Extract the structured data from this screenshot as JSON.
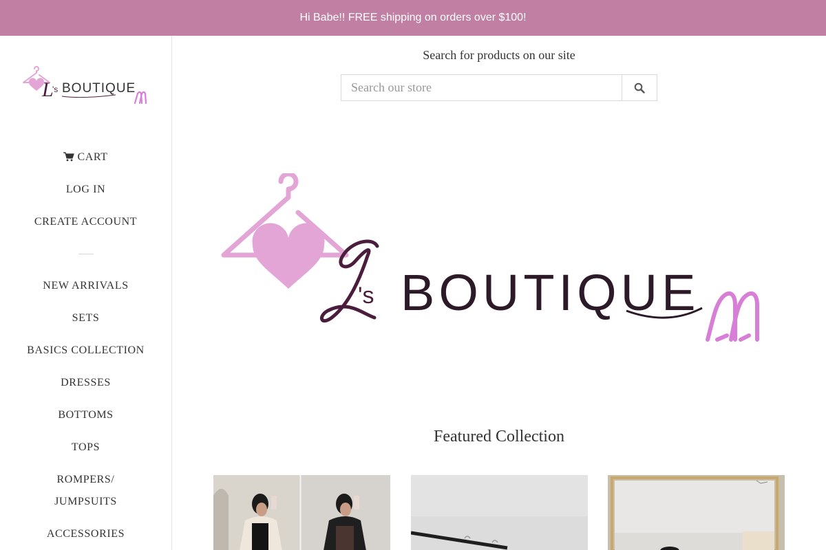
{
  "announcement": {
    "text": "Hi Babe!! FREE shipping on orders over $100!"
  },
  "brand": {
    "logo_text": "L's BOUTIQUE",
    "logo_letter": "L",
    "logo_suffix": "'s",
    "logo_word": "BOUTIQUE"
  },
  "sidebar": {
    "account_links": [
      {
        "label": "Cart"
      },
      {
        "label": "Log in"
      },
      {
        "label": "Create account"
      }
    ],
    "nav": [
      {
        "label": "New Arrivals"
      },
      {
        "label": "Sets"
      },
      {
        "label": "Basics Collection"
      },
      {
        "label": "Dresses"
      },
      {
        "label": "Bottoms"
      },
      {
        "label": "Tops"
      },
      {
        "label": "Rompers/"
      },
      {
        "label": "Jumpsuits"
      },
      {
        "label": "Accessories"
      }
    ]
  },
  "search": {
    "title": "Search for products on our site",
    "placeholder": "Search our store"
  },
  "featured": {
    "title": "Featured Collection"
  },
  "icons": {
    "cart": "cart-icon",
    "search": "search-icon",
    "hanger": "hanger-heart-icon",
    "heels": "high-heels-icon"
  },
  "colors": {
    "announcement_bg": "#c07fa3",
    "logo_pink": "#e2a5d6",
    "logo_plum": "#4a1d3d",
    "heels_pink": "#d77fd6"
  }
}
